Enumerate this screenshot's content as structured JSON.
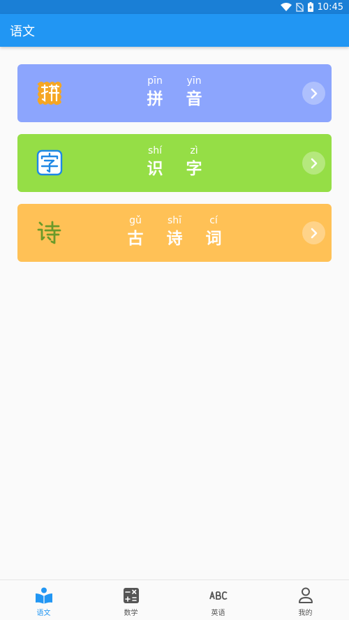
{
  "status_bar": {
    "time": "10:45"
  },
  "app_bar": {
    "title": "语文"
  },
  "cards": [
    {
      "color": "#8ca5fd",
      "icon": "pinyin-icon",
      "chars": [
        {
          "pinyin": "pīn",
          "hanzi": "拼"
        },
        {
          "pinyin": "yīn",
          "hanzi": "音"
        }
      ]
    },
    {
      "color": "#95de46",
      "icon": "zi-icon",
      "chars": [
        {
          "pinyin": "shí",
          "hanzi": "识"
        },
        {
          "pinyin": "zì",
          "hanzi": "字"
        }
      ]
    },
    {
      "color": "#ffc156",
      "icon": "shi-icon",
      "chars": [
        {
          "pinyin": "gǔ",
          "hanzi": "古"
        },
        {
          "pinyin": "shī",
          "hanzi": "诗"
        },
        {
          "pinyin": "cí",
          "hanzi": "词"
        }
      ]
    }
  ],
  "bottom_nav": {
    "items": [
      {
        "label": "语文",
        "icon": "book-reader-icon",
        "active": true
      },
      {
        "label": "数学",
        "icon": "calculator-icon",
        "active": false
      },
      {
        "label": "英语",
        "icon": "abc-icon",
        "active": false
      },
      {
        "label": "我的",
        "icon": "person-icon",
        "active": false
      }
    ],
    "accent_color": "#2196f3"
  }
}
